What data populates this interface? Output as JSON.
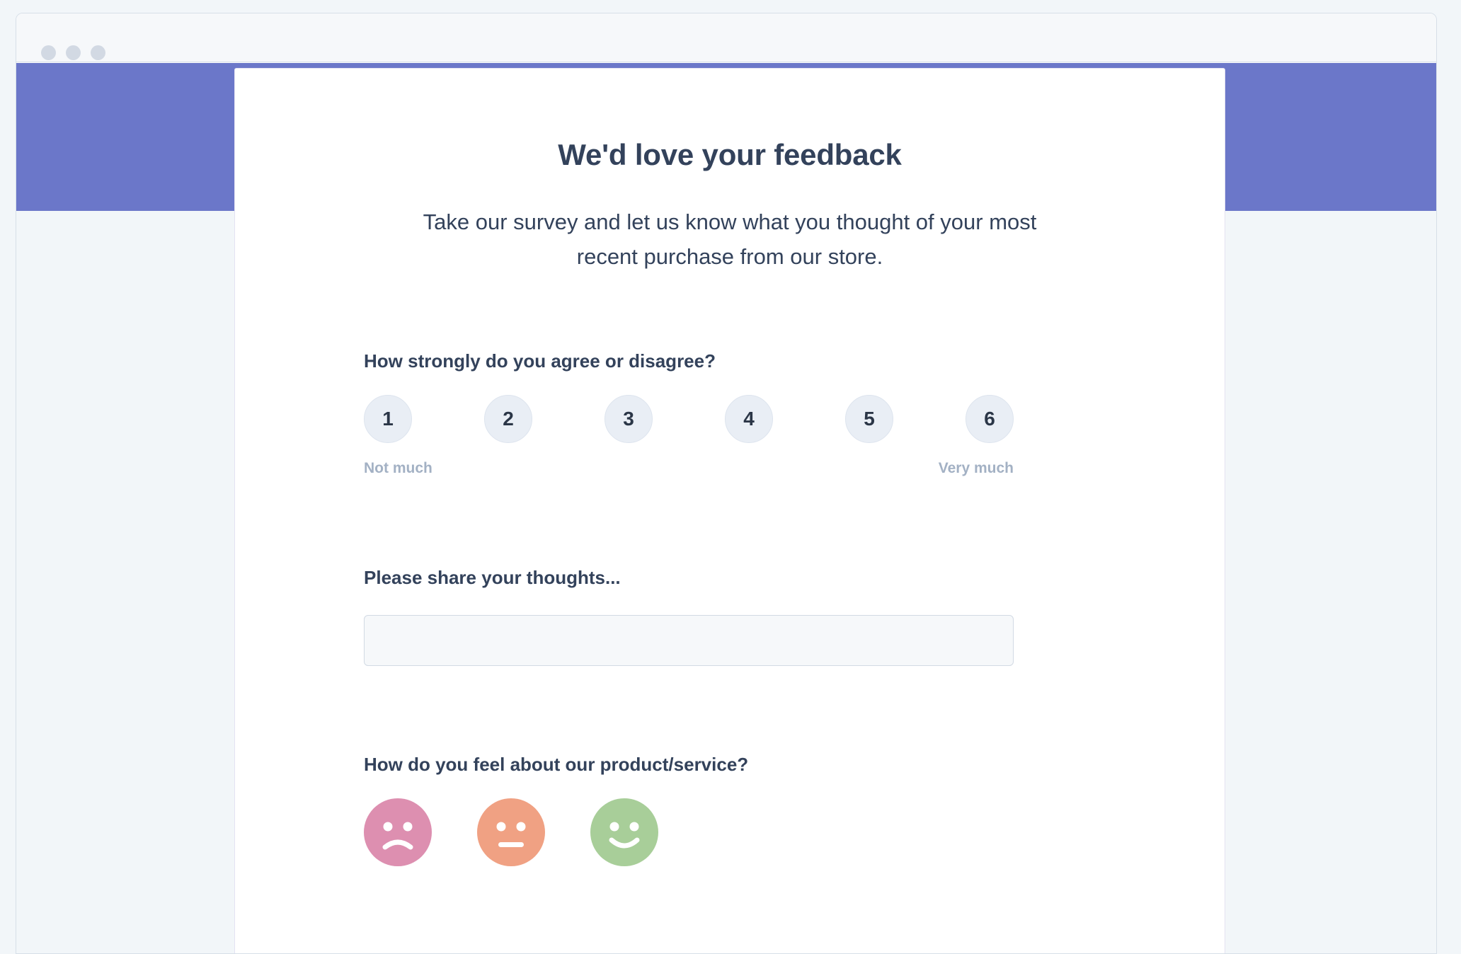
{
  "window": {
    "traffic_lights": [
      "close-dot",
      "minimize-dot",
      "maximize-dot"
    ]
  },
  "theme": {
    "banner_color": "#6b77c9",
    "page_background": "#f2f6f9",
    "card_background": "#ffffff",
    "heading_color": "#33425b",
    "muted_label_color": "#a3b1c4",
    "scale_chip_color": "#e9eef5",
    "face_sad_color": "#dd8fb0",
    "face_neutral_color": "#f0a183",
    "face_happy_color": "#a8ce99"
  },
  "survey": {
    "title": "We'd love your feedback",
    "subtitle": "Take our survey and let us know what you thought of your most recent purchase from our store.",
    "questions": {
      "agree": {
        "label": "How strongly do you agree or disagree?",
        "options": [
          "1",
          "2",
          "3",
          "4",
          "5",
          "6"
        ],
        "low_caption": "Not much",
        "high_caption": "Very much"
      },
      "thoughts": {
        "label": "Please share your thoughts...",
        "value": "",
        "placeholder": ""
      },
      "feelings": {
        "label": "How do you feel about our product/service?",
        "faces": [
          {
            "name": "sad-face",
            "color": "#dd8fb0"
          },
          {
            "name": "neutral-face",
            "color": "#f0a183"
          },
          {
            "name": "happy-face",
            "color": "#a8ce99"
          }
        ]
      }
    }
  }
}
